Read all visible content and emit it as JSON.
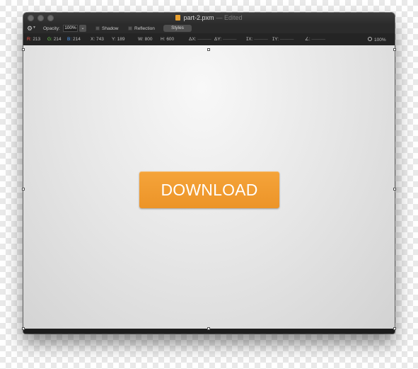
{
  "window": {
    "filename": "part-2.pxm",
    "status": "— Edited"
  },
  "toolbar": {
    "opacity_label": "Opacity:",
    "opacity_value": "100%",
    "shadow_label": "Shadow",
    "reflection_label": "Reflection",
    "styles_label": "Styles"
  },
  "infobar": {
    "r_label": "R:",
    "r_value": "213",
    "g_label": "G:",
    "g_value": "214",
    "b_label": "B:",
    "b_value": "214",
    "x_label": "X:",
    "x_value": "743",
    "y_label": "Y:",
    "y_value": "189",
    "w_label": "W:",
    "w_value": "800",
    "h_label": "H:",
    "h_value": "600",
    "dx_label": "ΔX:",
    "dy_label": "ΔY:",
    "ix_label": "ⵊX:",
    "iy_label": "ⵊY:",
    "angle_label": "∠:",
    "empty_value": "———",
    "zoom": "100%"
  },
  "canvas": {
    "button_label": "DOWNLOAD"
  },
  "colors": {
    "accent": "#EC9428",
    "canvas": "#D5D6D6"
  }
}
